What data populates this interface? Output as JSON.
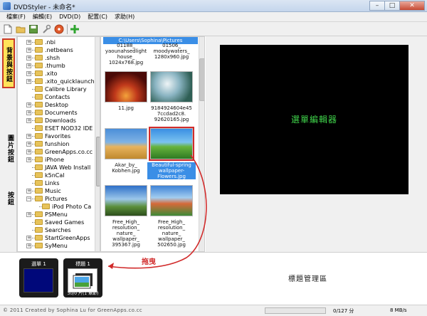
{
  "window": {
    "title": "DVDStyler - 未命名*",
    "minimize": "–",
    "maximize": "□",
    "close": "✕"
  },
  "menu": [
    "檔案(F)",
    "編輯(E)",
    "DVD(D)",
    "配置(C)",
    "求助(H)"
  ],
  "side_tabs": {
    "active": "背景與按鈕",
    "tab2": "圖片按鈕",
    "tab3": "按鈕"
  },
  "tree": [
    {
      "label": ".nbi",
      "depth": 0,
      "expander": "+"
    },
    {
      "label": ".netbeans",
      "depth": 0,
      "expander": "+"
    },
    {
      "label": ".shsh",
      "depth": 0,
      "expander": "+"
    },
    {
      "label": ".thumb",
      "depth": 0,
      "expander": "+"
    },
    {
      "label": ".xito",
      "depth": 0,
      "expander": "+"
    },
    {
      "label": ".xito_quicklaunch",
      "depth": 0,
      "expander": "+"
    },
    {
      "label": "Calibre Library",
      "depth": 0,
      "expander": ""
    },
    {
      "label": "Contacts",
      "depth": 0,
      "expander": ""
    },
    {
      "label": "Desktop",
      "depth": 0,
      "expander": "+"
    },
    {
      "label": "Documents",
      "depth": 0,
      "expander": "+"
    },
    {
      "label": "Downloads",
      "depth": 0,
      "expander": "+"
    },
    {
      "label": "ESET NOD32 IDE",
      "depth": 0,
      "expander": ""
    },
    {
      "label": "Favorites",
      "depth": 0,
      "expander": "+"
    },
    {
      "label": "funshion",
      "depth": 0,
      "expander": "+"
    },
    {
      "label": "GreenApps.co.cc",
      "depth": 0,
      "expander": "+"
    },
    {
      "label": "iPhone",
      "depth": 0,
      "expander": "+"
    },
    {
      "label": "JAVA Web Install",
      "depth": 0,
      "expander": ""
    },
    {
      "label": "k5nCal",
      "depth": 0,
      "expander": ""
    },
    {
      "label": "Links",
      "depth": 0,
      "expander": ""
    },
    {
      "label": "Music",
      "depth": 0,
      "expander": "+"
    },
    {
      "label": "Pictures",
      "depth": 0,
      "expander": "−"
    },
    {
      "label": "iPod Photo Ca",
      "depth": 1,
      "expander": ""
    },
    {
      "label": "PSMenu",
      "depth": 0,
      "expander": "+"
    },
    {
      "label": "Saved Games",
      "depth": 0,
      "expander": ""
    },
    {
      "label": "Searches",
      "depth": 0,
      "expander": ""
    },
    {
      "label": "StartGreenApps",
      "depth": 0,
      "expander": "+"
    },
    {
      "label": "SyMenu",
      "depth": 0,
      "expander": "+"
    }
  ],
  "gallery": {
    "path": "C:\\Users\\Sophina\\Pictures",
    "items": [
      {
        "caption": "01188_\nyaounahsedlight\nhouse_\n1024x768.jpg",
        "thumb": "",
        "selected": false
      },
      {
        "caption": "01506_\nmoodywaters_\n1280x960.jpg",
        "thumb": "",
        "selected": false
      },
      {
        "caption": "11.jpg",
        "thumb": "autumn",
        "selected": false
      },
      {
        "caption": "9184924604e45\n7ccdad2c8.\n92620165.jpg",
        "thumb": "tree",
        "selected": false
      },
      {
        "caption": "Akar_by_\nKobhen.jpg",
        "thumb": "desert",
        "selected": false
      },
      {
        "caption": "Beautiful-spring\nwallpaper-\nFlowers.jpg",
        "thumb": "spring",
        "selected": true
      },
      {
        "caption": "Free_High_\nresolution_\nnature_\nwallpaper_\n395367.jpg",
        "thumb": "mountain",
        "selected": false
      },
      {
        "caption": "Free_High_\nresolution_\nnature_\nwallpaper_\n502650.jpg",
        "thumb": "village",
        "selected": false
      }
    ]
  },
  "preview": {
    "menu_text": "選單編輯器"
  },
  "titleset": {
    "menu_label": "選單 1",
    "title_label": "標題 1",
    "title_sub": "30/0 片(1 章節)",
    "drag_label": "拖曳",
    "titles_area": "標題管理區"
  },
  "status": {
    "credit": "© 2011 Created by Sophina Lu for GreenApps.co.cc",
    "count": "0/127 分",
    "speed": "8 MB/s"
  },
  "colors": {
    "accent": "#3a8ee6",
    "drag_arrow": "#d12b2b",
    "menu_text": "#3fd24a"
  },
  "toolbar_icons": [
    "new-icon",
    "open-icon",
    "save-icon",
    "settings-icon",
    "burn-icon",
    "add-icon"
  ]
}
